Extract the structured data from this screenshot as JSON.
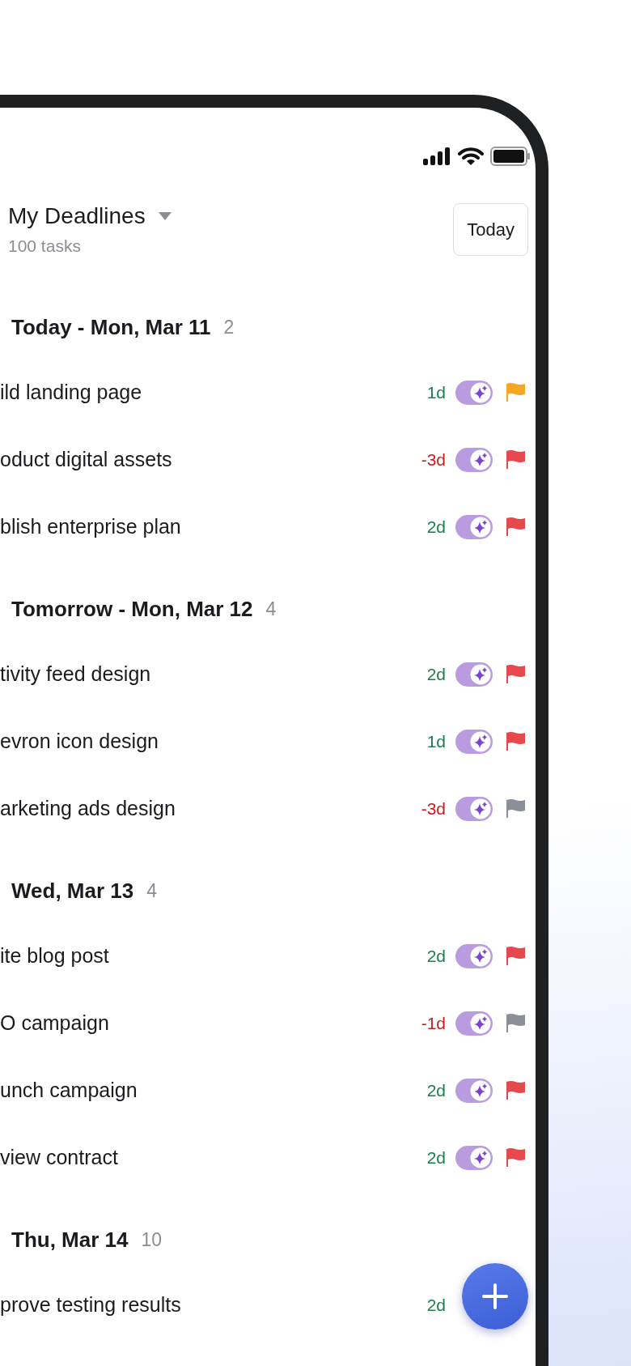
{
  "header": {
    "title": "My Deadlines",
    "subtitle": "100 tasks",
    "today_button": "Today"
  },
  "sections": [
    {
      "title": "Today - Mon, Mar 11",
      "count": "2",
      "tasks": [
        {
          "name": "ild landing page",
          "days": "1d",
          "overdue": false,
          "on": true,
          "flag": {
            "color": "#f7a823"
          }
        },
        {
          "name": "oduct digital assets",
          "days": "-3d",
          "overdue": true,
          "on": true,
          "flag": {
            "color": "#e5484d"
          }
        },
        {
          "name": "blish enterprise plan",
          "days": "2d",
          "overdue": false,
          "on": true,
          "flag": {
            "color": "#e5484d"
          }
        }
      ]
    },
    {
      "title": "Tomorrow - Mon, Mar 12",
      "count": "4",
      "tasks": [
        {
          "name": "tivity feed design",
          "days": "2d",
          "overdue": false,
          "on": true,
          "flag": {
            "color": "#e5484d"
          }
        },
        {
          "name": "evron icon design",
          "days": "1d",
          "overdue": false,
          "on": true,
          "flag": {
            "color": "#e5484d"
          }
        },
        {
          "name": "arketing ads design",
          "days": "-3d",
          "overdue": true,
          "on": true,
          "flag": {
            "color": "#8a8f98"
          }
        }
      ]
    },
    {
      "title": "Wed, Mar 13",
      "count": "4",
      "tasks": [
        {
          "name": "ite blog post",
          "days": "2d",
          "overdue": false,
          "on": true,
          "flag": {
            "color": "#e5484d"
          }
        },
        {
          "name": "O campaign",
          "days": "-1d",
          "overdue": true,
          "on": true,
          "flag": {
            "color": "#8a8f98"
          }
        },
        {
          "name": "unch campaign",
          "days": "2d",
          "overdue": false,
          "on": true,
          "flag": {
            "color": "#e5484d"
          }
        },
        {
          "name": "view contract",
          "days": "2d",
          "overdue": false,
          "on": true,
          "flag": {
            "color": "#e5484d"
          }
        }
      ]
    },
    {
      "title": "Thu, Mar 14",
      "count": "10",
      "tasks": [
        {
          "name": "prove testing results",
          "days": "2d",
          "overdue": false
        }
      ]
    }
  ]
}
